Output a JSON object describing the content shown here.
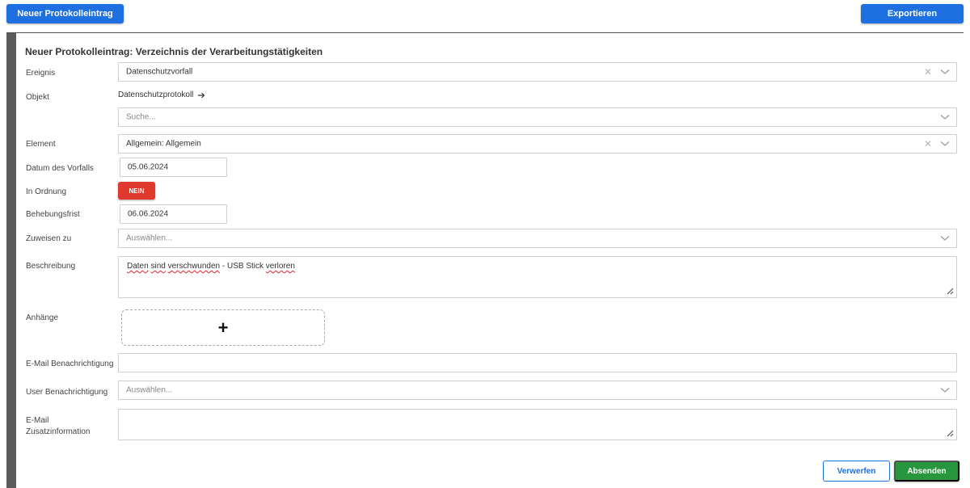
{
  "toolbar": {
    "new_entry_label": "Neuer Protokolleintrag",
    "export_label": "Exportieren"
  },
  "form": {
    "title": "Neuer Protokolleintrag: Verzeichnis der Verarbeitungstätigkeiten",
    "ereignis": {
      "label": "Ereignis",
      "value": "Datenschutzvorfall"
    },
    "objekt": {
      "label": "Objekt",
      "link_text": "Datenschutzprotokoll",
      "search_placeholder": "Suche..."
    },
    "element": {
      "label": "Element",
      "value": "Allgemein: Allgemein"
    },
    "datum": {
      "label": "Datum des Vorfalls",
      "value": "05.06.2024"
    },
    "in_ordnung": {
      "label": "In Ordnung",
      "toggle_label": "NEIN"
    },
    "behebungsfrist": {
      "label": "Behebungsfrist",
      "value": "06.06.2024"
    },
    "zuweisen": {
      "label": "Zuweisen zu",
      "placeholder": "Auswählen..."
    },
    "beschreibung": {
      "label": "Beschreibung",
      "value_parts": [
        "Daten",
        " ",
        "sind",
        " ",
        "verschwunden",
        " - USB Stick ",
        "verloren"
      ]
    },
    "anhaenge": {
      "label": "Anhänge",
      "add_symbol": "+"
    },
    "email_benachrichtigung": {
      "label": "E-Mail Benachrichtigung",
      "value": ""
    },
    "user_benachrichtigung": {
      "label": "User Benachrichtigung",
      "placeholder": "Auswählen..."
    },
    "email_zusatz": {
      "label_line1": "E-Mail",
      "label_line2": "Zusatzinformation",
      "value": ""
    }
  },
  "actions": {
    "discard_label": "Verwerfen",
    "submit_label": "Absenden"
  },
  "colors": {
    "primary": "#1e6fe0",
    "toggle_off": "#e03a2e",
    "submit": "#28963d"
  }
}
